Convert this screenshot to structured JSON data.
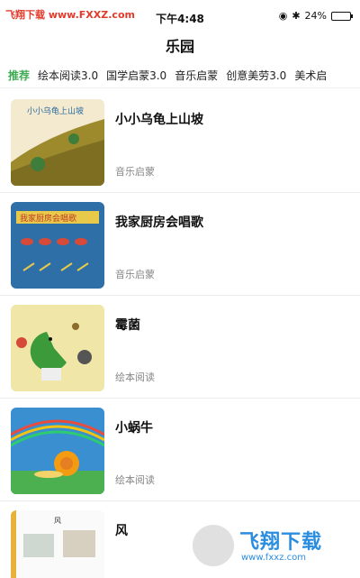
{
  "status_bar": {
    "watermark": "飞翔下载 www.FXXZ.com",
    "time": "下午4:48",
    "battery": "24%",
    "battery_level": 0.24
  },
  "header": {
    "title": "乐园"
  },
  "tabs": [
    {
      "label": "推荐",
      "active": true
    },
    {
      "label": "绘本阅读3.0"
    },
    {
      "label": "国学启蒙3.0"
    },
    {
      "label": "音乐启蒙"
    },
    {
      "label": "创意美劳3.0"
    },
    {
      "label": "美术启"
    }
  ],
  "items": [
    {
      "title": "小小乌龟上山坡",
      "category": "音乐启蒙",
      "thumb_text": "小小乌龟上山坡"
    },
    {
      "title": "我家厨房会唱歌",
      "category": "音乐启蒙",
      "thumb_text": "我家厨房会唱歌"
    },
    {
      "title": "霉菌",
      "category": "绘本阅读"
    },
    {
      "title": "小蜗牛",
      "category": "绘本阅读"
    },
    {
      "title": "风",
      "category": "",
      "thumb_text": "风"
    }
  ],
  "watermark_logo": {
    "text": "飞翔下载",
    "url": "www.fxxz.com"
  },
  "colors": {
    "accent": "#3cab52"
  }
}
